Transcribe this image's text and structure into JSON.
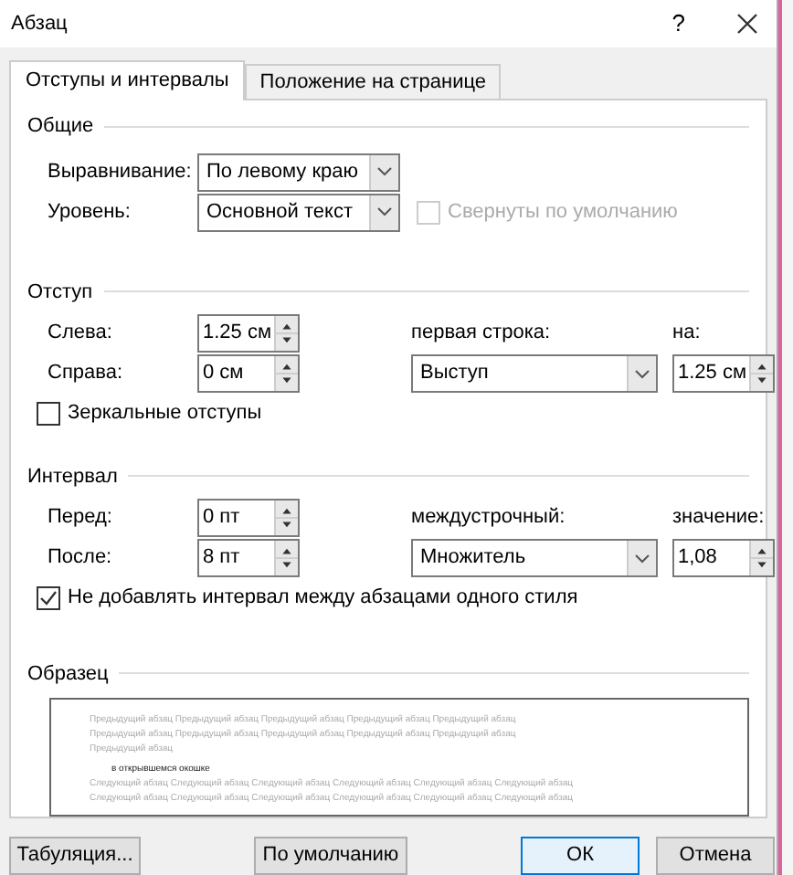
{
  "window": {
    "title": "Абзац",
    "help": "?"
  },
  "tabs": [
    {
      "label": "Отступы и интервалы",
      "selected": true
    },
    {
      "label": "Положение на странице",
      "selected": false
    }
  ],
  "general": {
    "title": "Общие",
    "alignment": {
      "label": "Выравнивание:",
      "value": "По левому краю"
    },
    "level": {
      "label": "Уровень:",
      "value": "Основной текст"
    },
    "collapsed": {
      "label": "Свернуты по умолчанию",
      "checked": false,
      "disabled": true
    }
  },
  "indent": {
    "title": "Отступ",
    "left": {
      "label": "Слева:",
      "value": "1.25 см"
    },
    "right": {
      "label": "Справа:",
      "value": "0 см"
    },
    "first_line": {
      "label": "первая строка:",
      "value": "Выступ"
    },
    "by": {
      "label": "на:",
      "value": "1.25 см"
    },
    "mirror": {
      "label": "Зеркальные отступы",
      "checked": false
    }
  },
  "spacing": {
    "title": "Интервал",
    "before": {
      "label": "Перед:",
      "value": "0 пт"
    },
    "after": {
      "label": "После:",
      "value": "8 пт"
    },
    "line_spacing": {
      "label": "междустрочный:",
      "value": "Множитель"
    },
    "at": {
      "label": "значение:",
      "value": "1,08"
    },
    "no_space": {
      "label": "Не добавлять интервал между абзацами одного стиля",
      "checked": true
    }
  },
  "preview": {
    "title": "Образец",
    "previous": [
      "Предыдущий абзац Предыдущий абзац Предыдущий абзац Предыдущий абзац Предыдущий абзац",
      "Предыдущий абзац Предыдущий абзац Предыдущий абзац Предыдущий абзац Предыдущий абзац",
      "Предыдущий абзац"
    ],
    "sample": "в открывшемся окошке",
    "next": [
      "Следующий абзац Следующий абзац Следующий абзац Следующий абзац Следующий абзац Следующий абзац",
      "Следующий абзац Следующий абзац Следующий абзац Следующий абзац Следующий абзац Следующий абзац"
    ]
  },
  "buttons": [
    {
      "label": "Табуляция...",
      "kind": "plain"
    },
    {
      "label": "По умолчанию",
      "kind": "plain"
    },
    {
      "label": "ОК",
      "kind": "default"
    },
    {
      "label": "Отмена",
      "kind": "plain"
    }
  ]
}
